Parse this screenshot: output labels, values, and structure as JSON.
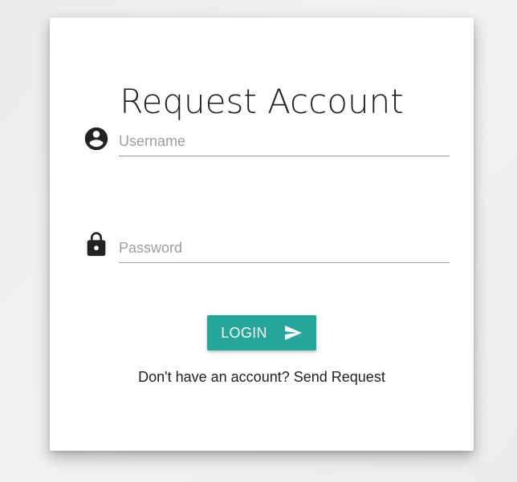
{
  "form": {
    "title": "Request Account",
    "username": {
      "icon": "account-circle-icon",
      "placeholder": "Username",
      "value": ""
    },
    "password": {
      "icon": "lock-icon",
      "placeholder": "Password",
      "value": ""
    },
    "login_button": {
      "label": "LOGIN",
      "icon": "send-icon",
      "color": "#26a69a"
    },
    "footer": {
      "text": "Don't have an account? ",
      "link_text": "Send Request"
    }
  }
}
